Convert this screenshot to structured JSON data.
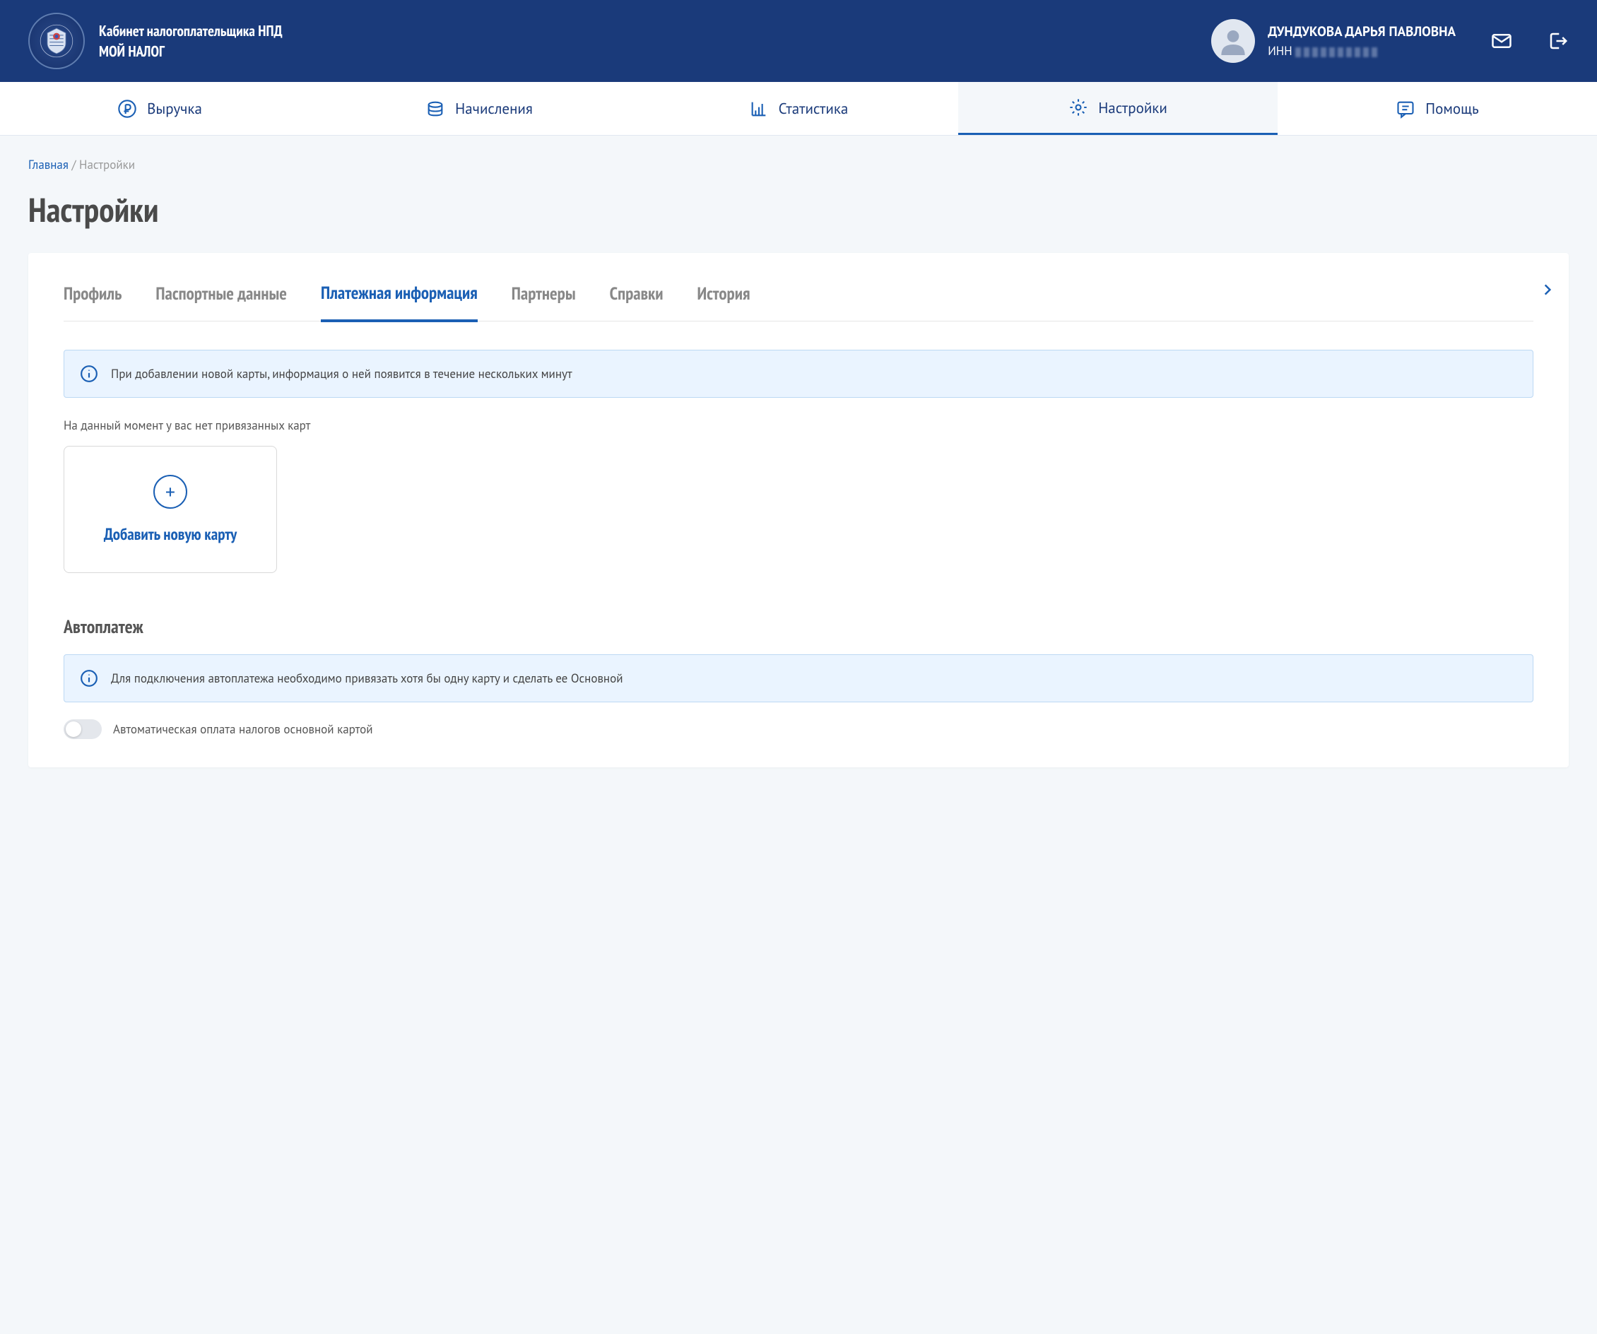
{
  "header": {
    "title_line1": "Кабинет налогоплательщика НПД",
    "title_line2": "МОЙ НАЛОГ",
    "user_name": "ДУНДУКОВА ДАРЬЯ ПАВЛОВНА",
    "inn_label": "ИНН"
  },
  "nav": {
    "items": [
      "Выручка",
      "Начисления",
      "Статистика",
      "Настройки",
      "Помощь"
    ],
    "active_index": 3
  },
  "breadcrumb": {
    "home": "Главная",
    "current": "Настройки"
  },
  "page_title": "Настройки",
  "subtabs": {
    "items": [
      "Профиль",
      "Паспортные данные",
      "Платежная информация",
      "Партнеры",
      "Справки",
      "История"
    ],
    "active_index": 2
  },
  "payment": {
    "info_message": "При добавлении новой карты, информация о ней появится в течение нескольких минут",
    "empty_message": "На данный момент у вас нет привязанных карт",
    "add_card_label": "Добавить новую карту"
  },
  "autopay": {
    "title": "Автоплатеж",
    "info_message": "Для подключения автоплатежа необходимо привязать хотя бы одну карту и сделать ее Основной",
    "toggle_label": "Автоматическая оплата налогов основной картой",
    "toggle_state": false
  }
}
